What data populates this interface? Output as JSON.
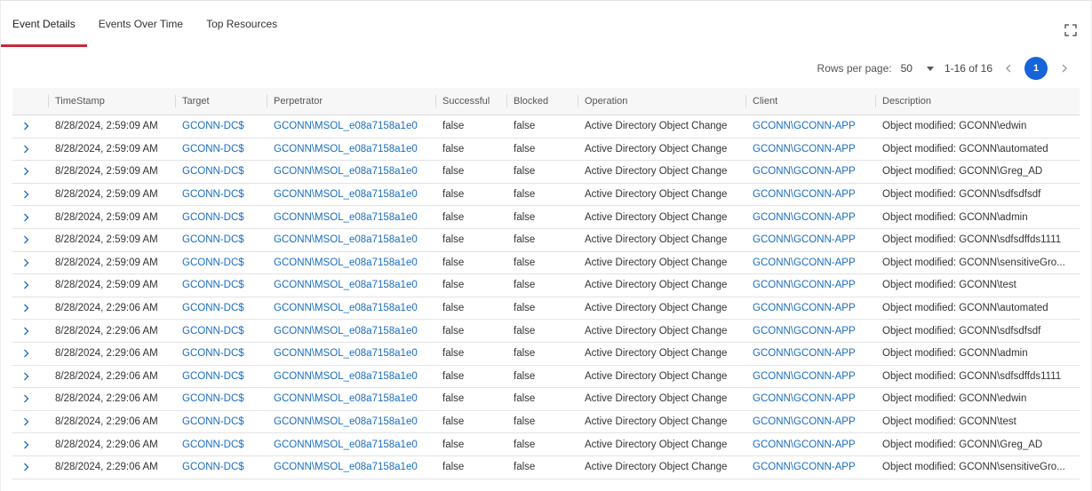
{
  "tabs": [
    "Event Details",
    "Events Over Time",
    "Top Resources"
  ],
  "active_tab": 0,
  "icons": {
    "expand": "fullscreen-expand-icon",
    "row_expand": "chevron-right-icon",
    "prev": "chevron-left-icon",
    "next": "chevron-right-icon"
  },
  "colors": {
    "accent": "#c8283a",
    "link": "#1a6dc1",
    "page_active": "#1565d8"
  },
  "pagination": {
    "rows_label": "Rows per page:",
    "rows_value": "50",
    "range": "1-16 of 16",
    "current_page": "1"
  },
  "table": {
    "columns": [
      "TimeStamp",
      "Target",
      "Perpetrator",
      "Successful",
      "Blocked",
      "Operation",
      "Client",
      "Description"
    ],
    "rows": [
      [
        "8/28/2024, 2:59:09 AM",
        "GCONN-DC$",
        "GCONN\\MSOL_e08a7158a1e0",
        "false",
        "false",
        "Active Directory Object Change",
        "GCONN\\GCONN-APP",
        "Object modified: GCONN\\edwin"
      ],
      [
        "8/28/2024, 2:59:09 AM",
        "GCONN-DC$",
        "GCONN\\MSOL_e08a7158a1e0",
        "false",
        "false",
        "Active Directory Object Change",
        "GCONN\\GCONN-APP",
        "Object modified: GCONN\\automated"
      ],
      [
        "8/28/2024, 2:59:09 AM",
        "GCONN-DC$",
        "GCONN\\MSOL_e08a7158a1e0",
        "false",
        "false",
        "Active Directory Object Change",
        "GCONN\\GCONN-APP",
        "Object modified: GCONN\\Greg_AD"
      ],
      [
        "8/28/2024, 2:59:09 AM",
        "GCONN-DC$",
        "GCONN\\MSOL_e08a7158a1e0",
        "false",
        "false",
        "Active Directory Object Change",
        "GCONN\\GCONN-APP",
        "Object modified: GCONN\\sdfsdfsdf"
      ],
      [
        "8/28/2024, 2:59:09 AM",
        "GCONN-DC$",
        "GCONN\\MSOL_e08a7158a1e0",
        "false",
        "false",
        "Active Directory Object Change",
        "GCONN\\GCONN-APP",
        "Object modified: GCONN\\admin"
      ],
      [
        "8/28/2024, 2:59:09 AM",
        "GCONN-DC$",
        "GCONN\\MSOL_e08a7158a1e0",
        "false",
        "false",
        "Active Directory Object Change",
        "GCONN\\GCONN-APP",
        "Object modified: GCONN\\sdfsdffds1111"
      ],
      [
        "8/28/2024, 2:59:09 AM",
        "GCONN-DC$",
        "GCONN\\MSOL_e08a7158a1e0",
        "false",
        "false",
        "Active Directory Object Change",
        "GCONN\\GCONN-APP",
        "Object modified: GCONN\\sensitiveGro..."
      ],
      [
        "8/28/2024, 2:59:09 AM",
        "GCONN-DC$",
        "GCONN\\MSOL_e08a7158a1e0",
        "false",
        "false",
        "Active Directory Object Change",
        "GCONN\\GCONN-APP",
        "Object modified: GCONN\\test"
      ],
      [
        "8/28/2024, 2:29:06 AM",
        "GCONN-DC$",
        "GCONN\\MSOL_e08a7158a1e0",
        "false",
        "false",
        "Active Directory Object Change",
        "GCONN\\GCONN-APP",
        "Object modified: GCONN\\automated"
      ],
      [
        "8/28/2024, 2:29:06 AM",
        "GCONN-DC$",
        "GCONN\\MSOL_e08a7158a1e0",
        "false",
        "false",
        "Active Directory Object Change",
        "GCONN\\GCONN-APP",
        "Object modified: GCONN\\sdfsdfsdf"
      ],
      [
        "8/28/2024, 2:29:06 AM",
        "GCONN-DC$",
        "GCONN\\MSOL_e08a7158a1e0",
        "false",
        "false",
        "Active Directory Object Change",
        "GCONN\\GCONN-APP",
        "Object modified: GCONN\\admin"
      ],
      [
        "8/28/2024, 2:29:06 AM",
        "GCONN-DC$",
        "GCONN\\MSOL_e08a7158a1e0",
        "false",
        "false",
        "Active Directory Object Change",
        "GCONN\\GCONN-APP",
        "Object modified: GCONN\\sdfsdffds1111"
      ],
      [
        "8/28/2024, 2:29:06 AM",
        "GCONN-DC$",
        "GCONN\\MSOL_e08a7158a1e0",
        "false",
        "false",
        "Active Directory Object Change",
        "GCONN\\GCONN-APP",
        "Object modified: GCONN\\edwin"
      ],
      [
        "8/28/2024, 2:29:06 AM",
        "GCONN-DC$",
        "GCONN\\MSOL_e08a7158a1e0",
        "false",
        "false",
        "Active Directory Object Change",
        "GCONN\\GCONN-APP",
        "Object modified: GCONN\\test"
      ],
      [
        "8/28/2024, 2:29:06 AM",
        "GCONN-DC$",
        "GCONN\\MSOL_e08a7158a1e0",
        "false",
        "false",
        "Active Directory Object Change",
        "GCONN\\GCONN-APP",
        "Object modified: GCONN\\Greg_AD"
      ],
      [
        "8/28/2024, 2:29:06 AM",
        "GCONN-DC$",
        "GCONN\\MSOL_e08a7158a1e0",
        "false",
        "false",
        "Active Directory Object Change",
        "GCONN\\GCONN-APP",
        "Object modified: GCONN\\sensitiveGro..."
      ]
    ]
  }
}
